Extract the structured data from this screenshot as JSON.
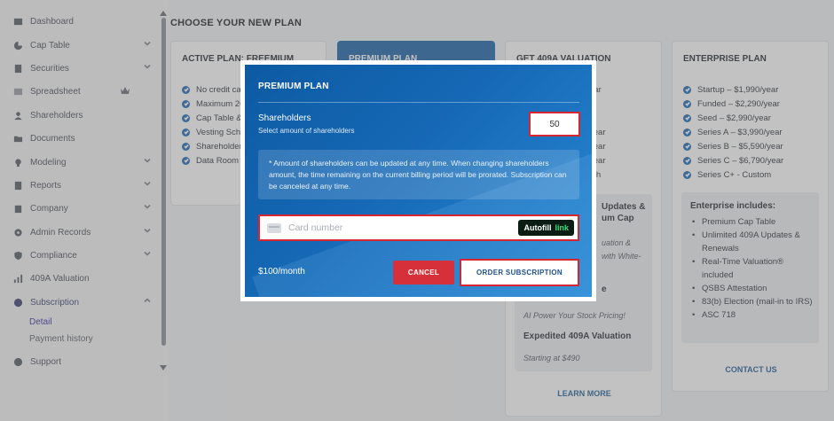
{
  "sidebar": {
    "items": [
      {
        "label": "Dashboard",
        "icon": "dashboard-icon"
      },
      {
        "label": "Cap Table",
        "icon": "pie-chart-icon"
      },
      {
        "label": "Securities",
        "icon": "document-icon"
      },
      {
        "label": "Spreadsheet",
        "icon": "table-icon"
      },
      {
        "label": "Shareholders",
        "icon": "person-icon"
      },
      {
        "label": "Documents",
        "icon": "folder-icon"
      },
      {
        "label": "Modeling",
        "icon": "lightbulb-icon"
      },
      {
        "label": "Reports",
        "icon": "report-icon"
      },
      {
        "label": "Company",
        "icon": "building-icon"
      },
      {
        "label": "Admin Records",
        "icon": "gear-icon"
      },
      {
        "label": "Compliance",
        "icon": "shield-icon"
      },
      {
        "label": "409A Valuation",
        "icon": "chart-icon"
      },
      {
        "label": "Subscription",
        "icon": "dollar-icon"
      },
      {
        "label": "Support",
        "icon": "support-icon"
      }
    ],
    "sub_items": {
      "detail": "Detail",
      "payment_history": "Payment history"
    }
  },
  "main": {
    "title": "CHOOSE YOUR NEW PLAN",
    "active_plan": {
      "head": "ACTIVE PLAN: FREEMIUM",
      "features": [
        "No credit card",
        "Maximum 20",
        "Cap Table &",
        "Vesting Sche",
        "Shareholder",
        "Data Room"
      ]
    },
    "premium_plan": {
      "head": "PREMIUM PLAN"
    },
    "valuation_plan": {
      "head": "GET 409A VALUATION",
      "features": [
        "ear",
        "r",
        "r",
        "year",
        "year",
        "year",
        "nth"
      ],
      "box_title": "Updates &\num Cap",
      "box_italic_1": "uation &\nwith White-",
      "box_title_2": "e",
      "box_italic_2": "AI Power Your Stock Pricing!",
      "box_title_3": "Expedited 409A Valuation",
      "box_italic_3": "Starting at $490",
      "learn_more": "LEARN MORE"
    },
    "enterprise_plan": {
      "head": "ENTERPRISE PLAN",
      "features": [
        "Startup – $1,990/year",
        "Funded – $2,290/year",
        "Seed – $2,990/year",
        "Series A – $3,990/year",
        "Series B – $5,590/year",
        "Series C – $6,790/year",
        "Series C+ - Custom"
      ],
      "includes_title": "Enterprise includes:",
      "includes": [
        "Premium Cap Table",
        "Unlimited 409A Updates & Renewals",
        "Real-Time Valuation® included",
        "QSBS Attestation",
        "83(b) Election (mail-in to IRS)",
        "ASC 718"
      ],
      "contact_us": "CONTACT US"
    }
  },
  "modal": {
    "title": "PREMIUM PLAN",
    "shareholders_label": "Shareholders",
    "shareholders_sub": "Select amount of shareholders",
    "shareholders_value": "50",
    "info_text": "* Amount of shareholders can be updated at any time. When changing shareholders amount, the time remaining on the current billing period will be prorated. Subscription can be canceled at any time.",
    "card_placeholder": "Card number",
    "autofill_1": "Autofill",
    "autofill_2": "link",
    "price": "$100/month",
    "cancel_label": "CANCEL",
    "order_label": "ORDER SUBSCRIPTION"
  },
  "colors": {
    "accent": "#1a63a8",
    "highlight_border": "#d7262f",
    "cancel": "#d6303a",
    "link_green": "#33e07a"
  }
}
